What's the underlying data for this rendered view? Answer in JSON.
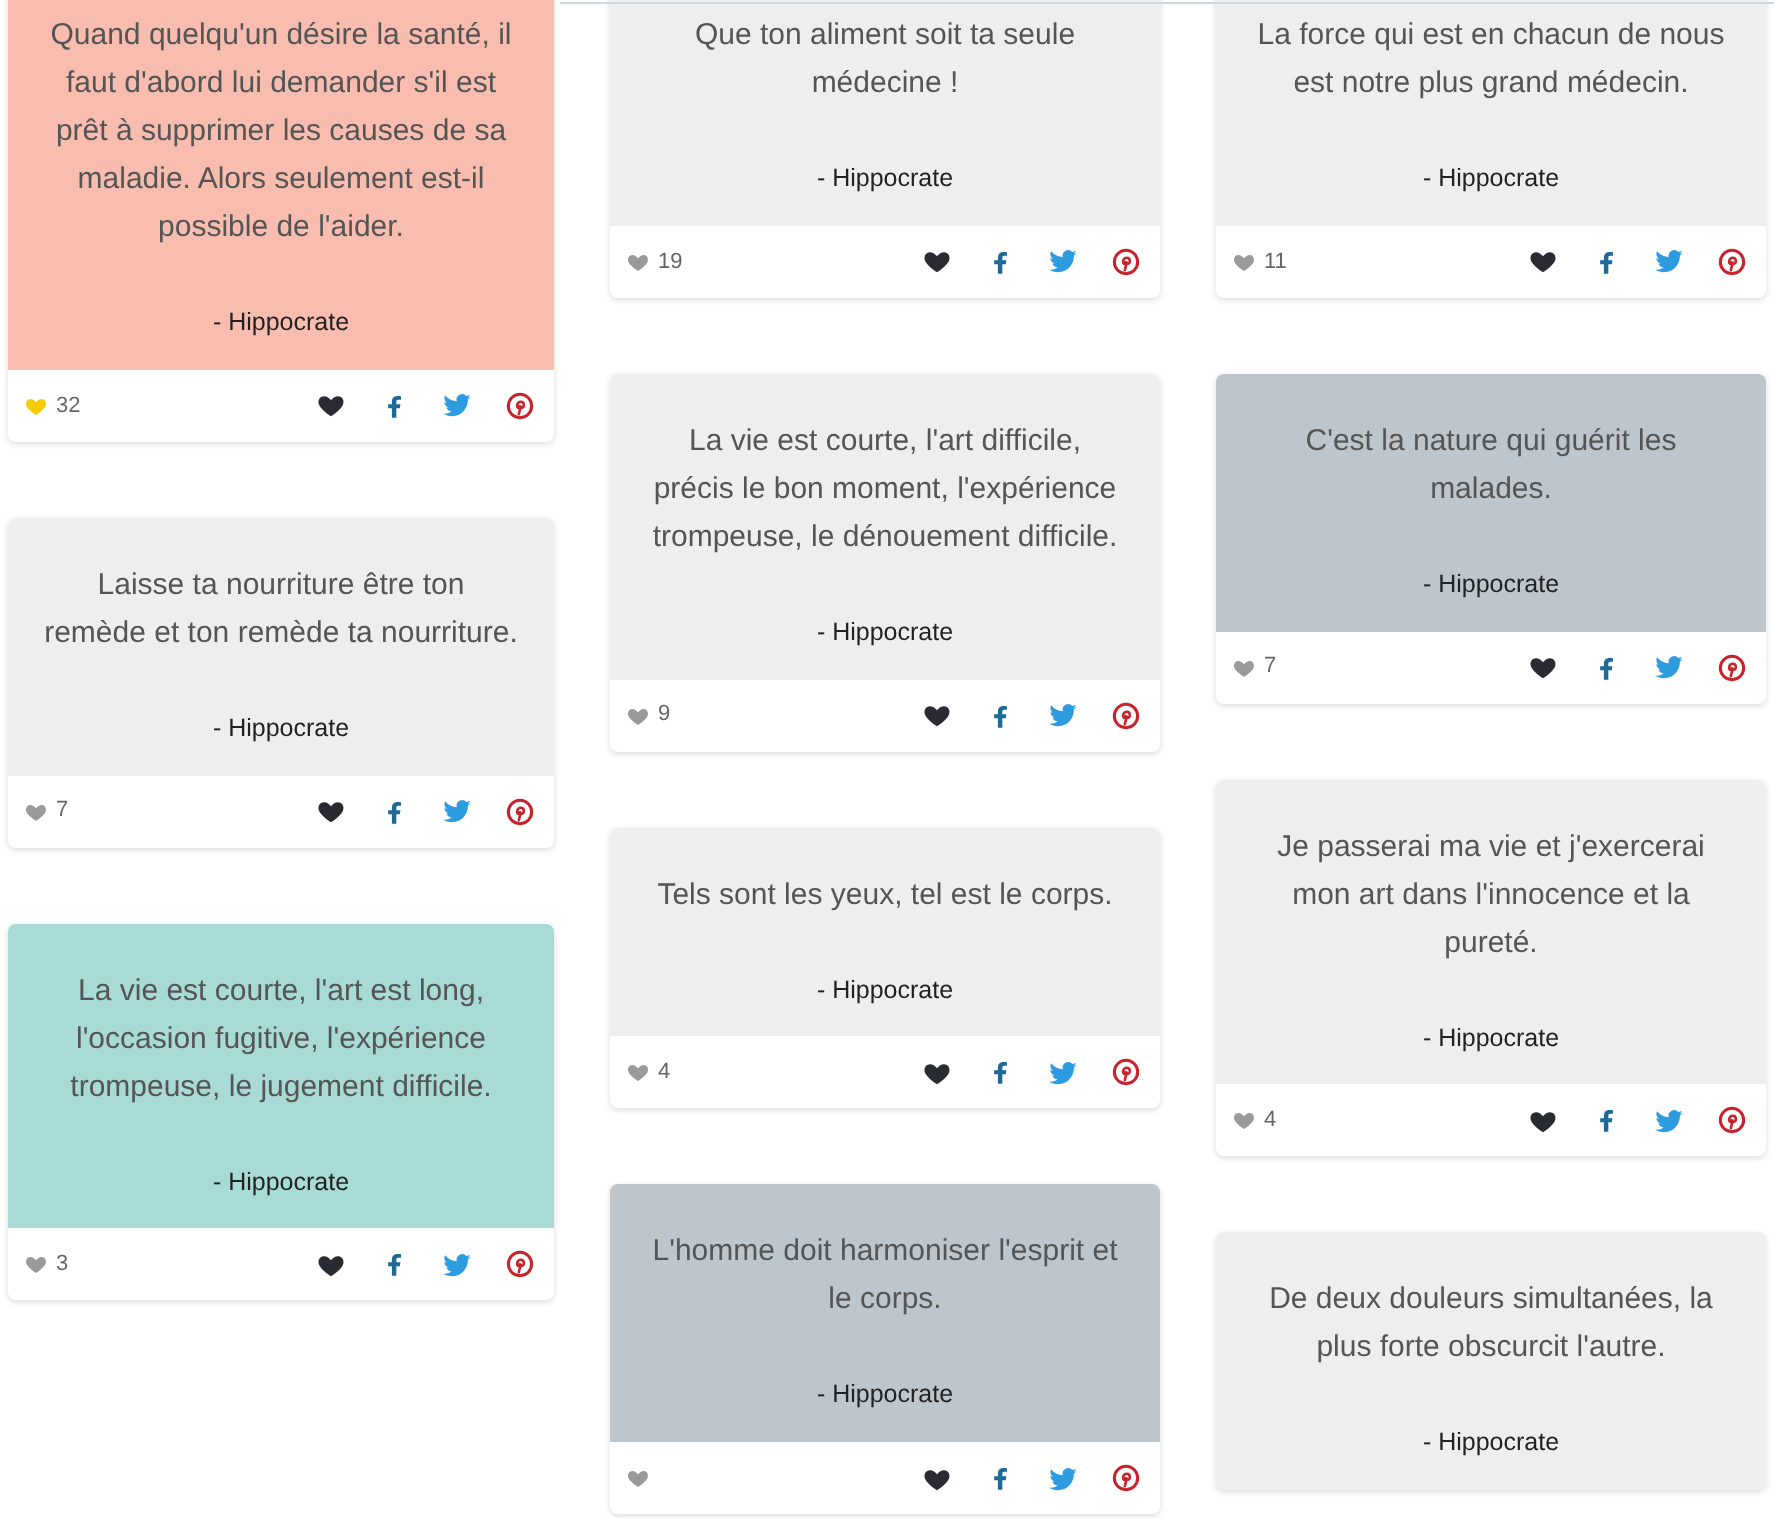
{
  "columns": [
    {
      "cards": [
        {
          "quote": "Quand quelqu'un désire la santé, il faut d'abord lui demander s'il est prêt à supprimer les causes de sa maladie. Alors seulement est-il possible de l'aider.",
          "author": "- Hippocrate",
          "color": "#f9bdb0",
          "liked": true,
          "likes": "32"
        },
        {
          "quote": "Laisse ta nourriture être ton remède et ton remède ta nourriture.",
          "author": "- Hippocrate",
          "color": "#eeeeee",
          "liked": false,
          "likes": "7"
        },
        {
          "quote": "La vie est courte, l'art est long, l'occasion fugitive, l'expérience trompeuse, le jugement difficile.",
          "author": "- Hippocrate",
          "color": "#a8dbd5",
          "liked": false,
          "likes": "3"
        }
      ]
    },
    {
      "cards": [
        {
          "quote": "Que ton aliment soit ta seule médecine !",
          "author": "- Hippocrate",
          "color": "#eeeeee",
          "liked": false,
          "likes": "19"
        },
        {
          "quote": "La vie est courte, l'art difficile, précis le bon moment, l'expérience trompeuse, le dénouement difficile.",
          "author": "- Hippocrate",
          "color": "#eeeeee",
          "liked": false,
          "likes": "9"
        },
        {
          "quote": "Tels sont les yeux, tel est le corps.",
          "author": "- Hippocrate",
          "color": "#eeeeee",
          "liked": false,
          "likes": "4"
        },
        {
          "quote": "L'homme doit harmoniser l'esprit et le corps.",
          "author": "- Hippocrate",
          "color": "#bcc6cc",
          "liked": false
        }
      ]
    },
    {
      "cards": [
        {
          "quote": "La force qui est en chacun de nous est notre plus grand médecin.",
          "author": "- Hippocrate",
          "color": "#eeeeee",
          "liked": false,
          "likes": "11"
        },
        {
          "quote": "C'est la nature qui guérit les malades.",
          "author": "- Hippocrate",
          "color": "#bcc6cc",
          "liked": false,
          "likes": "7"
        },
        {
          "quote": "Je passerai ma vie et j'exercerai mon art dans l'innocence et la pureté.",
          "author": "- Hippocrate",
          "color": "#eeeeee",
          "liked": false,
          "likes": "4"
        },
        {
          "quote": "De deux douleurs simultanées, la plus forte obscurcit l'autre.",
          "author": "- Hippocrate",
          "color": "#eeeeee"
        }
      ]
    }
  ]
}
